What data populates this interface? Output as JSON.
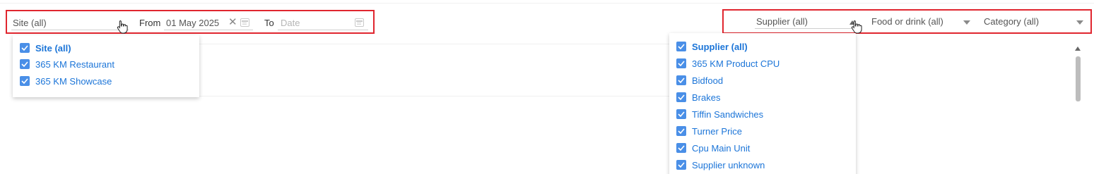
{
  "left_filters": {
    "site_value": "Site (all)",
    "from_label": "From",
    "from_value": "01 May 2025",
    "to_label": "To",
    "to_placeholder": "Date"
  },
  "right_filters": {
    "supplier_value": "Supplier (all)",
    "food_drink_value": "Food or drink (all)",
    "category_value": "Category (all)"
  },
  "site_dropdown": {
    "options": [
      {
        "label": "Site (all)",
        "checked": true
      },
      {
        "label": "365 KM Restaurant",
        "checked": true
      },
      {
        "label": "365 KM Showcase",
        "checked": true
      }
    ]
  },
  "supplier_dropdown": {
    "options": [
      {
        "label": "Supplier (all)",
        "checked": true
      },
      {
        "label": "365 KM Product CPU",
        "checked": true
      },
      {
        "label": "Bidfood",
        "checked": true
      },
      {
        "label": "Brakes",
        "checked": true
      },
      {
        "label": "Tiffin Sandwiches",
        "checked": true
      },
      {
        "label": "Turner Price",
        "checked": true
      },
      {
        "label": "Cpu Main Unit",
        "checked": true
      },
      {
        "label": "Supplier unknown",
        "checked": true
      }
    ]
  },
  "colors": {
    "highlight_border": "#e0262f",
    "checkbox": "#4a8fe7",
    "option_text": "#1c75d8"
  },
  "icons": [
    "clear-icon",
    "calendar-icon",
    "chevron-down-icon",
    "hand-pointer-cursor-icon",
    "scroll-up-icon",
    "checkbox-checked-icon"
  ]
}
